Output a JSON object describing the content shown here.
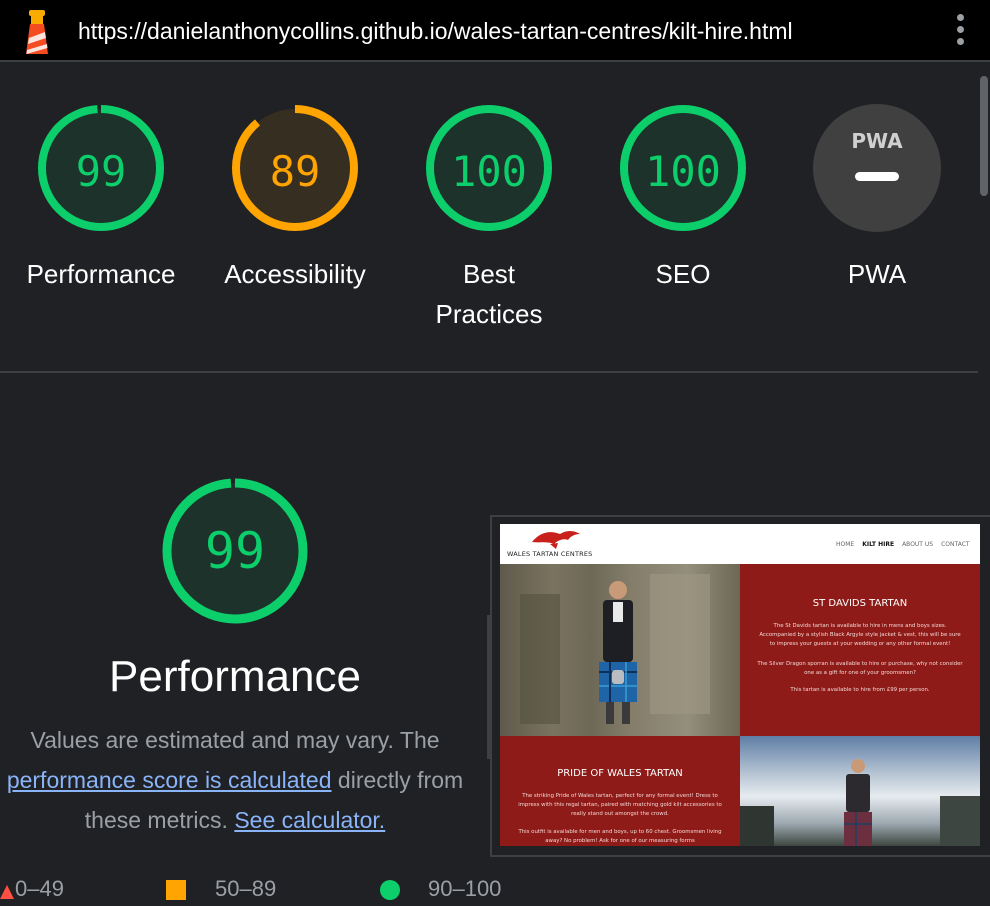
{
  "browser": {
    "url": "https://danielanthonycollins.github.io/wales-tartan-centres/kilt-hire.html"
  },
  "colors": {
    "pass": "#0cce6b",
    "average": "#ffa400",
    "pwa_gray": "#404040",
    "background": "#202124"
  },
  "scores": [
    {
      "label": "Performance",
      "value": "99",
      "fraction": 0.99,
      "status": "pass"
    },
    {
      "label": "Accessibility",
      "value": "89",
      "fraction": 0.89,
      "status": "average"
    },
    {
      "label": "Best\nPractices",
      "value": "100",
      "fraction": 1.0,
      "status": "pass"
    },
    {
      "label": "SEO",
      "value": "100",
      "fraction": 1.0,
      "status": "pass"
    },
    {
      "label": "PWA",
      "value": "",
      "status": "na",
      "badge": "PWA"
    }
  ],
  "performance": {
    "score": "99",
    "fraction": 0.99,
    "title": "Performance",
    "desc_part1": "Values are estimated and may vary. The ",
    "desc_link1": "performance score is calculated",
    "desc_part2": " directly from these metrics. ",
    "desc_link2": "See calculator."
  },
  "legend": {
    "fail": "0–49",
    "average": "50–89",
    "pass": "90–100"
  },
  "thumbnail": {
    "site_name": "WALES TARTAN CENTRES",
    "nav": [
      "HOME",
      "KILT HIRE",
      "ABOUT US",
      "CONTACT"
    ],
    "section1_title": "ST DAVIDS TARTAN",
    "section1_p1": "The St Davids tartan is available to hire in mens and boys sizes. Accompanied by a stylish Black Argyle style jacket & vest, this will be sure to impress your guests at your wedding or any other formal event!",
    "section1_p2": "The Silver Dragon sporran is available to hire or purchase, why not consider one as a gift for one of your groomsmen?",
    "section1_p3": "This tartan is available to hire from £99 per person.",
    "section2_title": "PRIDE OF WALES TARTAN",
    "section2_p1": "The striking Pride of Wales tartan, perfect for any formal event! Dress to impress with this regal tartan, paired with matching gold kilt accessories to really stand out amongst the crowd.",
    "section2_p2": "This outfit is available for men and boys, up to 60 chest. Groomsmen living away? No problem! Ask for one of our measuring forms"
  }
}
